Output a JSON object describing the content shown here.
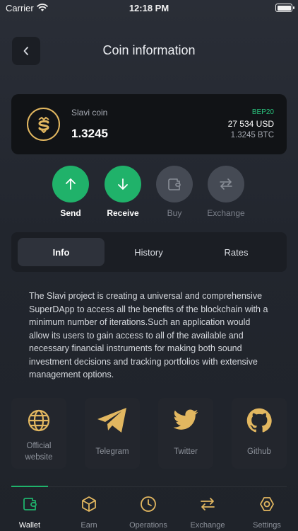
{
  "status_bar": {
    "carrier": "Carrier",
    "time": "12:18 PM"
  },
  "header": {
    "title": "Coin information",
    "back_icon": "chevron-left-icon"
  },
  "coin": {
    "name": "Slavi coin",
    "amount": "1.3245",
    "network": "BEP20",
    "usd_value": "27 534",
    "usd_unit": "USD",
    "btc_value": "1.3245",
    "btc_unit": "BTC",
    "logo_icon": "slavi-logo-icon"
  },
  "actions": [
    {
      "label": "Send",
      "icon": "arrow-up-icon",
      "enabled": true
    },
    {
      "label": "Receive",
      "icon": "arrow-down-icon",
      "enabled": true
    },
    {
      "label": "Buy",
      "icon": "wallet-icon",
      "enabled": false
    },
    {
      "label": "Exchange",
      "icon": "swap-icon",
      "enabled": false
    }
  ],
  "tabs": [
    {
      "label": "Info",
      "active": true
    },
    {
      "label": "History",
      "active": false
    },
    {
      "label": "Rates",
      "active": false
    }
  ],
  "description": "The Slavi project is creating a universal and comprehensive SuperDApp to access all the benefits of the blockchain with a minimum number of iterations.Such an application would allow its users to gain access to all of the available and necessary financial instruments for making both sound investment decisions and tracking portfolios with extensive management options.",
  "links": [
    {
      "label_line1": "Official",
      "label_line2": "website",
      "icon": "globe-icon"
    },
    {
      "label_line1": "Telegram",
      "label_line2": "",
      "icon": "telegram-icon"
    },
    {
      "label_line1": "Twitter",
      "label_line2": "",
      "icon": "twitter-icon"
    },
    {
      "label_line1": "Github",
      "label_line2": "",
      "icon": "github-icon"
    }
  ],
  "nav": [
    {
      "label": "Wallet",
      "icon": "wallet-icon",
      "active": true
    },
    {
      "label": "Earn",
      "icon": "cube-icon",
      "active": false
    },
    {
      "label": "Operations",
      "icon": "clock-icon",
      "active": false
    },
    {
      "label": "Exchange",
      "icon": "swap-icon",
      "active": false
    },
    {
      "label": "Settings",
      "icon": "gear-icon",
      "active": false
    }
  ],
  "colors": {
    "accent_green": "#20b26a",
    "gold": "#e2b760",
    "background": "#22262e",
    "card": "#111316"
  }
}
